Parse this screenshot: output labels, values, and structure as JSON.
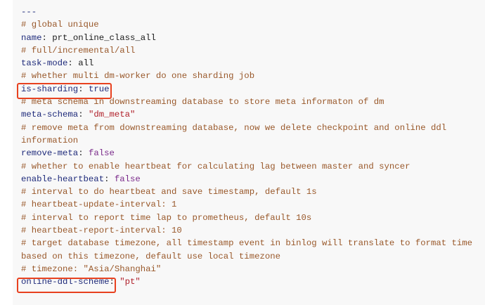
{
  "code": {
    "separator": "---",
    "comment_global_unique": "# global unique",
    "name_key": "name",
    "name_value": "prt_online_class_all",
    "comment_task_mode": "# full/incremental/all",
    "task_mode_key": "task-mode",
    "task_mode_value": "all",
    "comment_sharding": "# whether multi dm-worker do one sharding job",
    "is_sharding_key": "is-sharding",
    "is_sharding_value": "true",
    "comment_meta_schema": "# meta schema in downstreaming database to store meta informaton of dm",
    "meta_schema_key": "meta-schema",
    "meta_schema_value": "\"dm_meta\"",
    "comment_remove_meta_1": "# remove meta from downstreaming database, now we delete checkpoint and online ddl",
    "comment_remove_meta_2": "information",
    "remove_meta_key": "remove-meta",
    "remove_meta_value": "false",
    "comment_heartbeat": "# whether to enable heartbeat for calculating lag between master and syncer",
    "enable_heartbeat_key": "enable-heartbeat",
    "enable_heartbeat_value": "false",
    "comment_hb_interval": "# interval to do heartbeat and save timestamp, default 1s",
    "comment_hb_update": "# heartbeat-update-interval: 1",
    "comment_report_interval": "# interval to report time lap to prometheus, default 10s",
    "comment_hb_report": "# heartbeat-report-interval: 10",
    "comment_timezone_1": "# target database timezone, all timestamp event in binlog will translate to format time",
    "comment_timezone_2": "based on this timezone, default use local timezone",
    "comment_timezone_example": "# timezone: \"Asia/Shanghai\"",
    "online_ddl_key": "online-ddl-scheme",
    "online_ddl_value": "\"pt\""
  },
  "highlight_color": "#e8411f"
}
